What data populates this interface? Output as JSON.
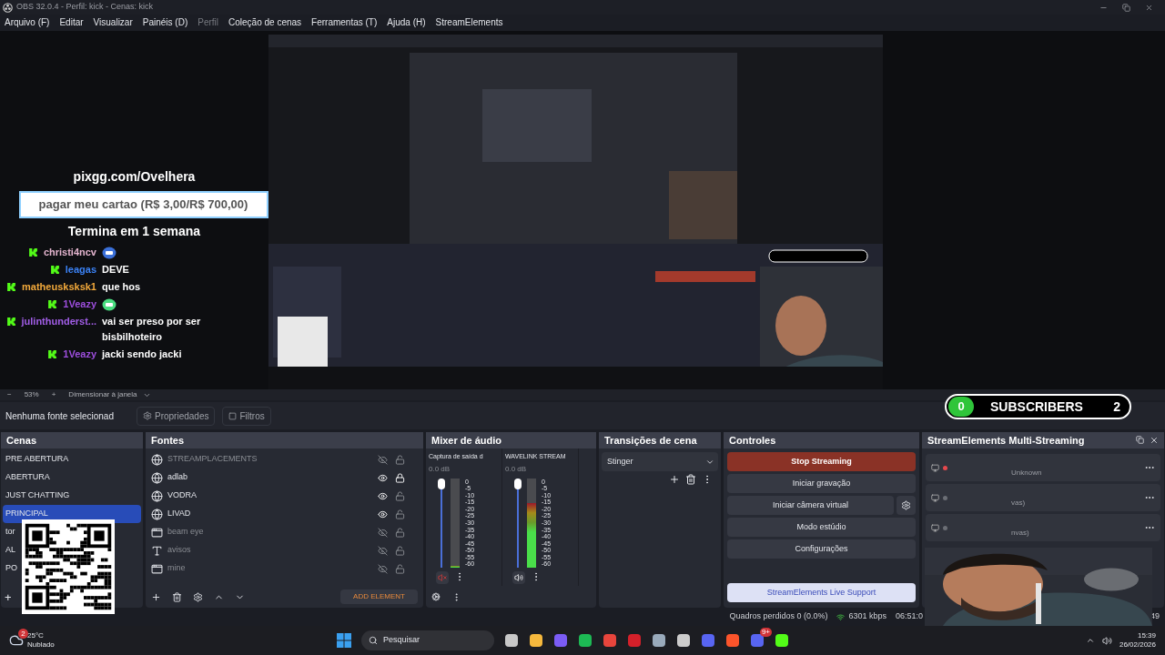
{
  "window": {
    "title": "OBS 32.0.4 - Perfil: kick - Cenas: kick"
  },
  "menu": [
    {
      "label": "Arquivo (F)",
      "disabled": false
    },
    {
      "label": "Editar",
      "disabled": false
    },
    {
      "label": "Visualizar",
      "disabled": false
    },
    {
      "label": "Painéis (D)",
      "disabled": false
    },
    {
      "label": "Perfil",
      "disabled": true
    },
    {
      "label": "Coleção de cenas",
      "disabled": false
    },
    {
      "label": "Ferramentas (T)",
      "disabled": false
    },
    {
      "label": "Ajuda (H)",
      "disabled": false
    },
    {
      "label": "StreamElements",
      "disabled": false
    }
  ],
  "overlay": {
    "link": "pixgg.com/Ovelhera",
    "goal": "pagar meu cartao (R$ 3,00/R$ 700,00)",
    "ends": "Termina em 1 semana",
    "chat": [
      {
        "user": "christi4ncv",
        "color": "#e4b5cf",
        "kind": "emote"
      },
      {
        "user": "leagas",
        "color": "#3b82f6",
        "kind": "text",
        "text": "DEVE"
      },
      {
        "user": "matheusksksk1",
        "color": "#f2a93b",
        "kind": "text",
        "text": "que hos"
      },
      {
        "user": "1Veazy",
        "color": "#9d4edd",
        "kind": "emote"
      },
      {
        "user": "julinthunderst...",
        "color": "#a25ee8",
        "kind": "text",
        "text": "vai ser preso por ser bisbilhoteiro"
      },
      {
        "user": "1Veazy",
        "color": "#9d4edd",
        "kind": "text",
        "text": "jacki sendo jacki"
      }
    ],
    "subscribers": {
      "count": "0",
      "label": "SUBSCRIBERS",
      "goal": "2"
    }
  },
  "zoom_bar": {
    "minus": "−",
    "zoom": "53%",
    "plus": "+",
    "mode": "Dimensionar à janela"
  },
  "source_bar": {
    "status": "Nenhuma fonte selecionad",
    "buttons": [
      "Propriedades",
      "Filtros"
    ]
  },
  "scenes": {
    "title": "Cenas",
    "items": [
      {
        "label": "PRE ABERTURA",
        "selected": false
      },
      {
        "label": "ABERTURA",
        "selected": false
      },
      {
        "label": "JUST CHATTING",
        "selected": false
      },
      {
        "label": "PRINCIPAL",
        "selected": true
      },
      {
        "label": "tor",
        "selected": false
      },
      {
        "label": "AL",
        "selected": false
      },
      {
        "label": "PO",
        "selected": false
      }
    ],
    "add": "+"
  },
  "sources": {
    "title": "Fontes",
    "items": [
      {
        "name": "STREAMPLACEMENTS",
        "kind": "browser",
        "visible": false,
        "locked": false
      },
      {
        "name": "adlab",
        "kind": "browser",
        "visible": true,
        "locked": true
      },
      {
        "name": "VODRA",
        "kind": "browser",
        "visible": true,
        "locked": false
      },
      {
        "name": "LIVAD",
        "kind": "browser",
        "visible": true,
        "locked": false
      },
      {
        "name": "beam eye",
        "kind": "window",
        "visible": false,
        "locked": false
      },
      {
        "name": "avisos",
        "kind": "text",
        "visible": false,
        "locked": false
      },
      {
        "name": "mine",
        "kind": "window",
        "visible": false,
        "locked": false
      }
    ],
    "add_element": "ADD ELEMENT"
  },
  "mixer": {
    "title": "Mixer de áudio",
    "channels": [
      {
        "name": "Captura de saída d",
        "reading": "0.0 dB",
        "muted": true,
        "level": 1,
        "meter": {
          "level": 0
        },
        "ticks": [
          "0",
          "-5",
          "-10",
          "-15",
          "-20",
          "-25",
          "-30",
          "-35",
          "-40",
          "-45",
          "-50",
          "-55",
          "-60"
        ]
      },
      {
        "name": "WAVELINK STREAM",
        "reading": "0.0 dB",
        "muted": false,
        "level": 1,
        "meter": {
          "level": 0.72
        },
        "ticks": [
          "0",
          "-5",
          "-10",
          "-15",
          "-20",
          "-25",
          "-30",
          "-35",
          "-40",
          "-45",
          "-50",
          "-55",
          "-60"
        ]
      }
    ]
  },
  "transitions": {
    "title": "Transições de cena",
    "selected": "Stinger"
  },
  "controls": {
    "title": "Controles",
    "buttons": [
      {
        "label": "Stop Streaming",
        "kind": "active"
      },
      {
        "label": "Iniciar gravação",
        "kind": "normal"
      },
      {
        "label": "Iniciar câmera virtual",
        "kind": "settings"
      },
      {
        "label": "Modo estúdio",
        "kind": "normal"
      },
      {
        "label": "Configurações",
        "kind": "normal"
      },
      {
        "label": "StreamElements Live Support",
        "kind": "link"
      }
    ]
  },
  "multistream": {
    "title": "StreamElements Multi-Streaming",
    "rows": [
      {
        "text": "Unknown",
        "live": true
      },
      {
        "text": "vas)",
        "live": false
      },
      {
        "text": "nvas)",
        "live": false
      }
    ]
  },
  "status_bar": {
    "dropped": "Quadros perdidos 0 (0.0%)",
    "bitrate": "6301 kbps",
    "time": "06:51:0",
    "extra": "49"
  },
  "taskbar": {
    "temp": "25°C",
    "weather": "Nublado",
    "weather_badge": "2",
    "search": "Pesquisar",
    "discord_badge": "9+",
    "time": "15:39",
    "date": "26/02/2026"
  }
}
